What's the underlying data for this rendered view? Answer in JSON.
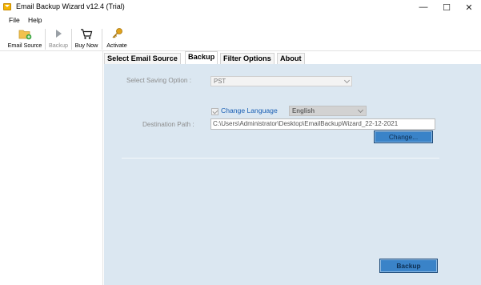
{
  "window": {
    "title": "Email Backup Wizard v12.4 (Trial)",
    "minimize": "—",
    "maximize": "☐",
    "close": "✕"
  },
  "menu": [
    "File",
    "Help"
  ],
  "toolbar": [
    {
      "label": "Email Source",
      "icon": "folder-add-icon",
      "enabled": true
    },
    {
      "label": "Backup",
      "icon": "play-icon",
      "enabled": false
    },
    {
      "label": "Buy Now",
      "icon": "cart-icon",
      "enabled": true
    },
    {
      "label": "Activate",
      "icon": "key-icon",
      "enabled": true
    }
  ],
  "tabs": [
    "Select Email Source",
    "Backup",
    "Filter Options",
    "About"
  ],
  "active_tab": "Backup",
  "form": {
    "saving_option_label": "Select Saving Option :",
    "saving_option_value": "PST",
    "change_language_label": "Change Language",
    "change_language_checked": true,
    "language_value": "English",
    "destination_label": "Destination Path :",
    "destination_value": "C:\\Users\\Administrator\\Desktop\\EmailBackupWizard_22-12-2021",
    "change_button": "Change...",
    "backup_button": "Backup"
  },
  "colors": {
    "content_bg": "#dbe7f1",
    "button_blue": "#3a83c8",
    "link_blue": "#1a5fb4"
  }
}
